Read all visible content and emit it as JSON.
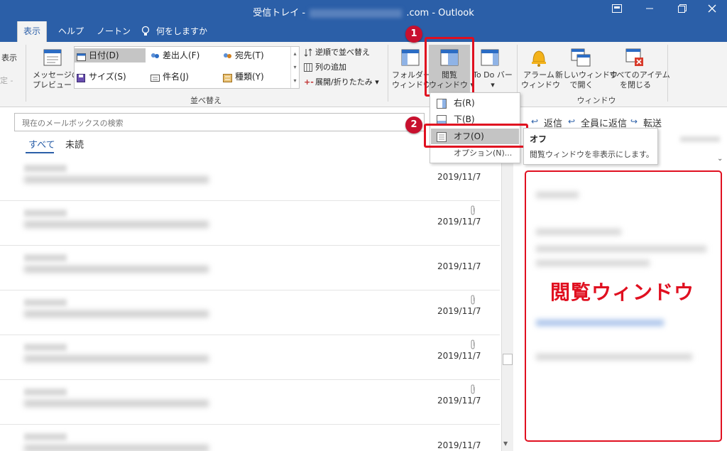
{
  "window": {
    "title_prefix": "受信トレイ -",
    "title_suffix": ".com  -  Outlook"
  },
  "menu": {
    "tabs": [
      {
        "label": "表示"
      },
      {
        "label": "ヘルプ"
      },
      {
        "label": "ノートン"
      }
    ],
    "tell_me": "何をしますか"
  },
  "ribbon": {
    "cut_left_1": "表示",
    "cut_left_2": "定 -",
    "preview_line1": "メッセージの",
    "preview_line2": "プレビュー",
    "sort": {
      "items": [
        {
          "label": "日付(D)"
        },
        {
          "label": "差出人(F)"
        },
        {
          "label": "宛先(T)"
        },
        {
          "label": "サイズ(S)"
        },
        {
          "label": "件名(J)"
        },
        {
          "label": "種類(Y)"
        }
      ],
      "reverse": "逆順で並べ替え",
      "add_column": "列の追加",
      "expand": "展開/折りたたみ",
      "group_label": "並べ替え"
    },
    "layout": {
      "folder_line1": "フォルダー",
      "folder_line2": "ウィンドウ",
      "reading_line1": "閲覧",
      "reading_line2": "ウィンドウ",
      "todo_line1": "To Do バー",
      "todo_line2": ""
    },
    "window_group": {
      "alarm_line1": "アラーム",
      "alarm_line2": "ウィンドウ",
      "newwin_line1": "新しいウィンドウ",
      "newwin_line2": "で開く",
      "closeall_line1": "すべてのアイテム",
      "closeall_line2": "を閉じる",
      "group_label": "ウィンドウ"
    }
  },
  "badges": {
    "one": "1",
    "two": "2"
  },
  "dropdown": {
    "items": [
      {
        "label": "右(R)"
      },
      {
        "label": "下(B)"
      },
      {
        "label": "オフ(O)"
      }
    ],
    "options": "オプション(N)..."
  },
  "tooltip": {
    "title": "オフ",
    "desc": "閲覧ウィンドウを非表示にします。"
  },
  "search": {
    "placeholder": "現在のメールボックスの検索"
  },
  "filters": {
    "all": "すべて",
    "unread": "未読"
  },
  "messages": [
    {
      "date": "2019/11/7",
      "attachment": false
    },
    {
      "date": "2019/11/7",
      "attachment": true
    },
    {
      "date": "2019/11/7",
      "attachment": false
    },
    {
      "date": "2019/11/7",
      "attachment": true
    },
    {
      "date": "2019/11/7",
      "attachment": true
    },
    {
      "date": "2019/11/7",
      "attachment": true
    },
    {
      "date": "2019/11/7",
      "attachment": false
    }
  ],
  "reading_pane": {
    "reply": "返信",
    "reply_all": "全員に返信",
    "forward": "転送",
    "annotation": "閲覧ウィンドウ"
  },
  "colors": {
    "brand": "#2b5fa8",
    "highlight": "#e01020"
  }
}
